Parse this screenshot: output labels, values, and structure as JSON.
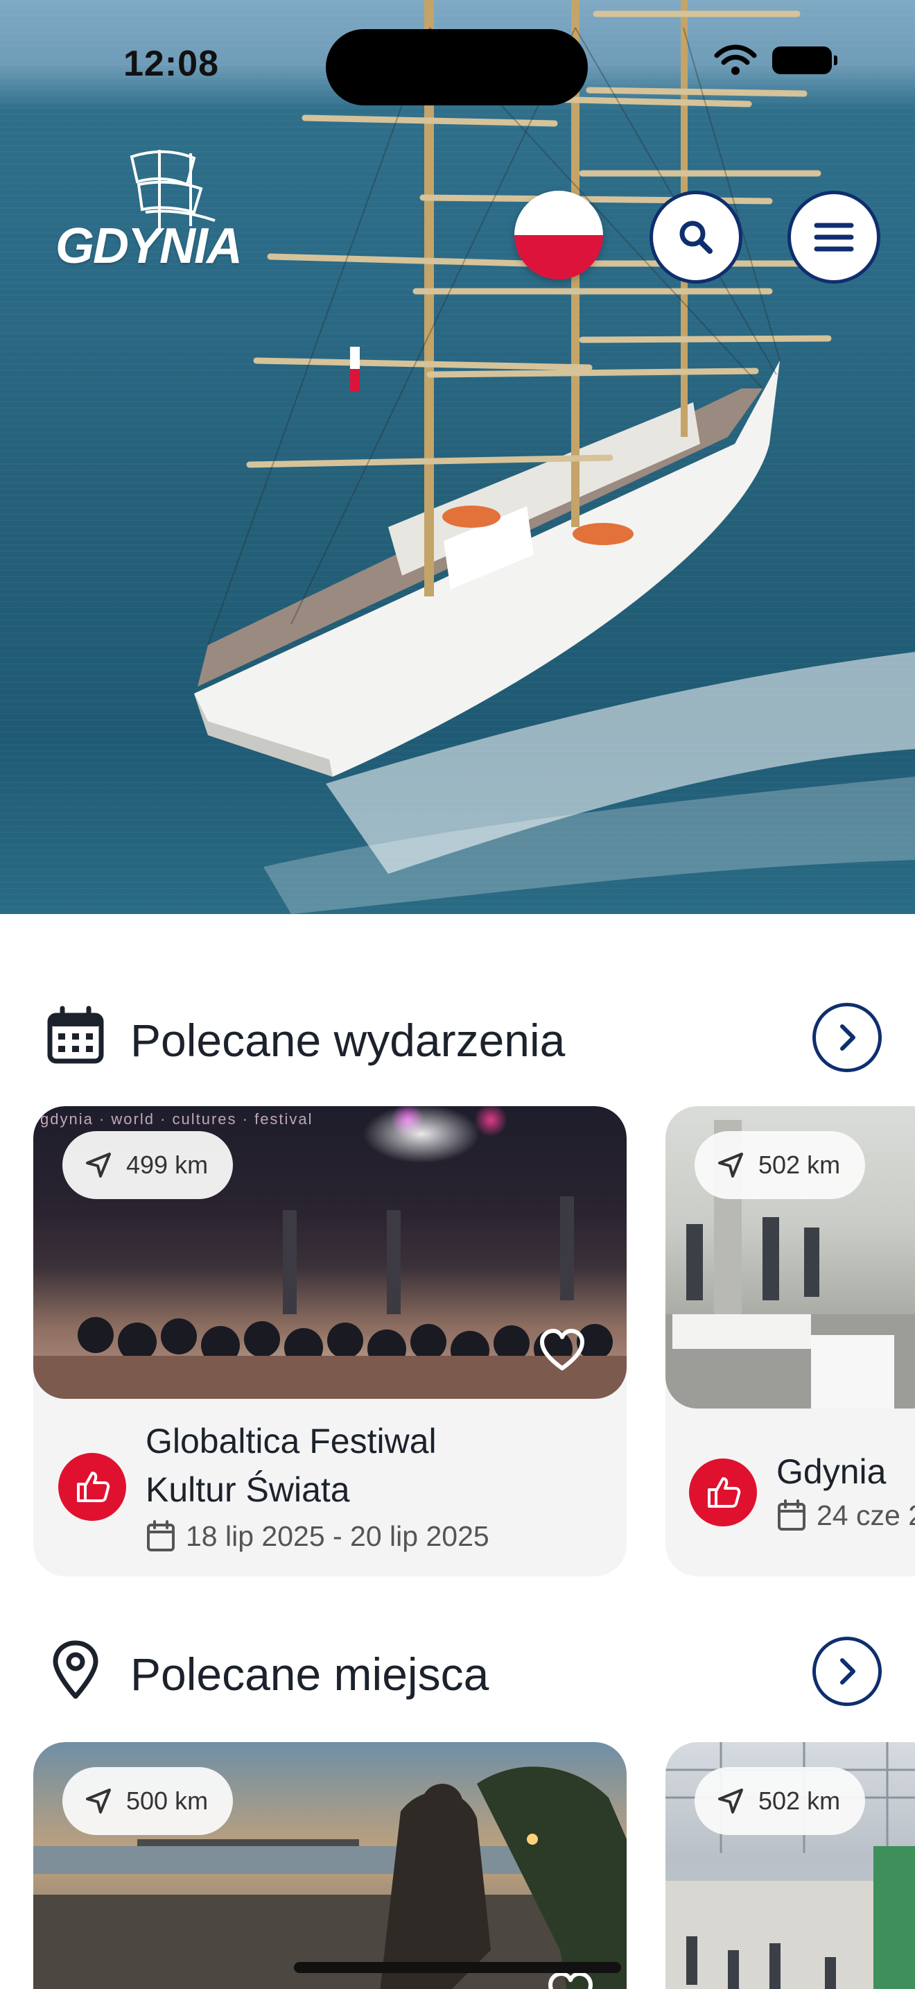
{
  "status_bar": {
    "time": "12:08"
  },
  "header": {
    "logo_text": "GDYNIA",
    "language": "pl",
    "search_icon": "search-icon",
    "menu_icon": "menu-icon"
  },
  "colors": {
    "navy": "#0f2e6e",
    "red": "#e0112f",
    "card_bg": "#f4f4f4"
  },
  "events": {
    "title": "Polecane wydarzenia",
    "icon": "calendar-icon",
    "cards": [
      {
        "distance": "499 km",
        "title_line1": "Globaltica Festiwal",
        "title_line2": "Kultur Świata",
        "date": "18 lip 2025 - 20 lip 2025",
        "banner": "gdynia · world · cultures · festival"
      },
      {
        "distance": "502 km",
        "title_line1": "Gdynia",
        "date": "24 cze 2"
      }
    ]
  },
  "places": {
    "title": "Polecane miejsca",
    "icon": "map-pin-icon",
    "cards": [
      {
        "distance": "500 km"
      },
      {
        "distance": "502 km"
      }
    ]
  }
}
